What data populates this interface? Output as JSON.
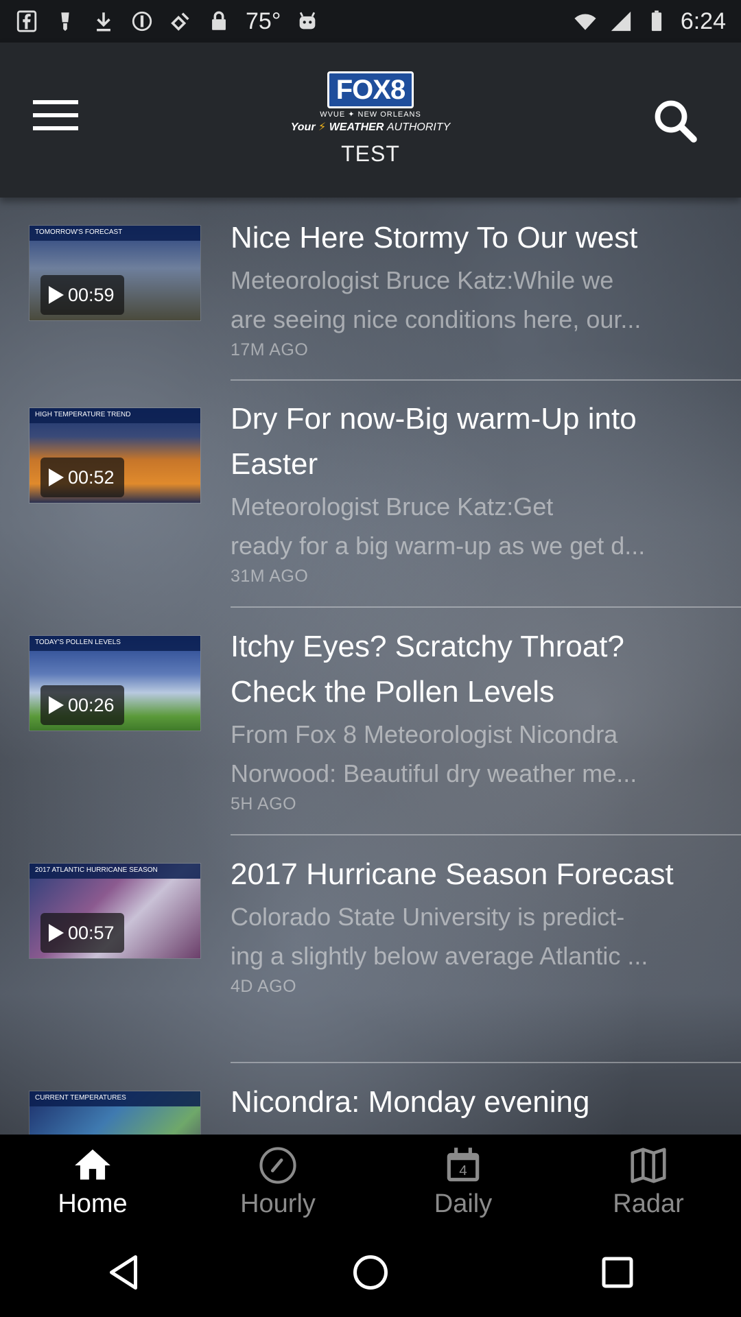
{
  "status_bar": {
    "temperature": "75°",
    "time": "6:24",
    "icons": [
      "fb-icon",
      "tip-icon",
      "download-icon",
      "circle-i-icon",
      "satellite-icon",
      "lock-icon",
      "android-icon",
      "wifi-icon",
      "signal-icon",
      "battery-icon"
    ]
  },
  "header": {
    "logo_main": "FOX8",
    "logo_sub": "WVUE ✦ NEW ORLEANS",
    "logo_tagline_1": "Your",
    "logo_tagline_2": "WEATHER",
    "logo_tagline_3": "AUTHORITY",
    "title": "TEST"
  },
  "news": [
    {
      "duration": "00:59",
      "thumb_caption": "TOMORROW'S FORECAST",
      "title": "Nice Here Stormy To Our west",
      "desc_1": "Meteorologist Bruce Katz:While we",
      "desc_2": "are seeing nice conditions here, our...",
      "time": "17M AGO"
    },
    {
      "duration": "00:52",
      "thumb_caption": "HIGH TEMPERATURE TREND",
      "title": "Dry For now-Big warm-Up into Easter",
      "desc_1": "Meteorologist Bruce Katz:Get",
      "desc_2": "ready for a big warm-up as we get d...",
      "time": "31M AGO"
    },
    {
      "duration": "00:26",
      "thumb_caption": "TODAY'S POLLEN LEVELS",
      "title": "Itchy Eyes? Scratchy Throat? Check the Pollen Levels",
      "desc_1": "From Fox 8 Meteorologist Nicondra",
      "desc_2": "Norwood: Beautiful dry weather me...",
      "time": "5H AGO"
    },
    {
      "duration": "00:57",
      "thumb_caption": "2017 ATLANTIC HURRICANE SEASON",
      "title": "2017 Hurricane Season Forecast",
      "desc_1": "Colorado State University is predict-",
      "desc_2": "ing a slightly below average Atlantic ...",
      "time": "4D AGO"
    },
    {
      "duration": "",
      "thumb_caption": "CURRENT TEMPERATURES",
      "title": "Nicondra: Monday evening",
      "desc_1": "",
      "desc_2": "",
      "time": ""
    }
  ],
  "bottom_nav": {
    "tabs": [
      {
        "label": "Home",
        "icon": "home-icon",
        "active": true
      },
      {
        "label": "Hourly",
        "icon": "clock-icon",
        "active": false
      },
      {
        "label": "Daily",
        "icon": "calendar-icon",
        "active": false
      },
      {
        "label": "Radar",
        "icon": "map-icon",
        "active": false
      }
    ],
    "daily_icon_number": "4"
  },
  "colors": {
    "accent": "#1f4e9c",
    "bolt": "#f3b51b",
    "nav_active": "#ffffff",
    "nav_inactive": "#8b8b8b"
  }
}
